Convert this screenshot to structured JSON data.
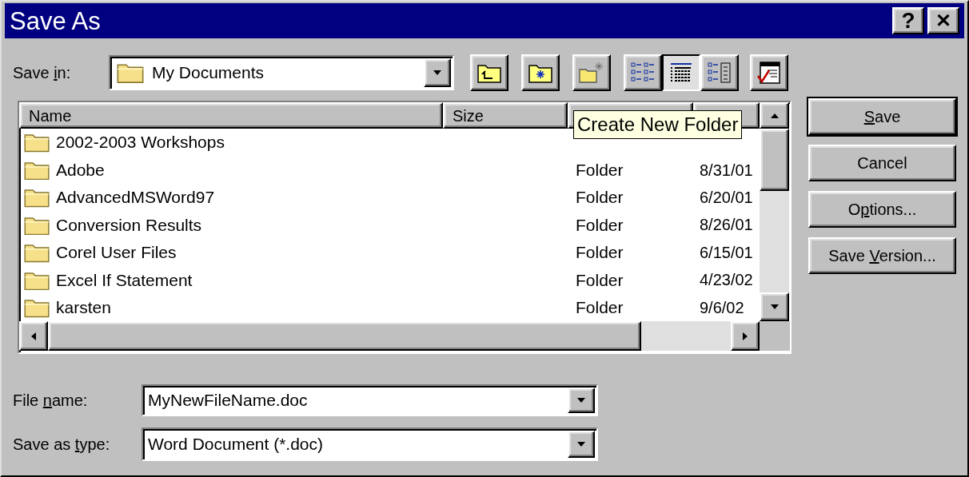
{
  "window": {
    "title": "Save As"
  },
  "title_buttons": [
    {
      "kind": "help",
      "label": "?"
    },
    {
      "kind": "close",
      "label": "✕"
    }
  ],
  "save_in": {
    "label": {
      "pre": "Save ",
      "key": "i",
      "post": "n:"
    },
    "value": "My Documents"
  },
  "toolbar": [
    {
      "kind": "up-folder"
    },
    {
      "kind": "web-folder"
    },
    {
      "kind": "new-folder"
    }
  ],
  "view_buttons": [
    {
      "kind": "list",
      "selected": false
    },
    {
      "kind": "details",
      "selected": true
    },
    {
      "kind": "properties",
      "selected": false
    }
  ],
  "tools_button": {
    "kind": "tools"
  },
  "table": {
    "columns": [
      {
        "label": "Name"
      },
      {
        "label": "Size"
      }
    ],
    "rows": [
      {
        "name": "2002-2003 Workshops"
      },
      {
        "name": "Adobe",
        "type": "Folder",
        "modified": "8/31/01"
      },
      {
        "name": "AdvancedMSWord97",
        "type": "Folder",
        "modified": "6/20/01"
      },
      {
        "name": "Conversion Results",
        "type": "Folder",
        "modified": "8/26/01"
      },
      {
        "name": "Corel User Files",
        "type": "Folder",
        "modified": "6/15/01"
      },
      {
        "name": "Excel If Statement",
        "type": "Folder",
        "modified": "4/23/02"
      },
      {
        "name": "karsten",
        "type": "Folder",
        "modified": "9/6/02"
      }
    ]
  },
  "tooltip": "Create New Folder",
  "buttons": [
    {
      "key": "S",
      "post": "ave",
      "default": true
    },
    {
      "pre": "Cancel",
      "default": false
    },
    {
      "pre": "O",
      "key": "p",
      "post": "tions...",
      "default": false
    },
    {
      "pre": "Save ",
      "key": "V",
      "post": "ersion...",
      "default": false
    }
  ],
  "file_name": {
    "label": {
      "pre": "File ",
      "key": "n",
      "post": "ame:"
    },
    "value": "MyNewFileName.doc"
  },
  "save_as_type": {
    "label": {
      "pre": "Save as ",
      "key": "t",
      "post": "ype:"
    },
    "value": "Word Document (*.doc)"
  }
}
